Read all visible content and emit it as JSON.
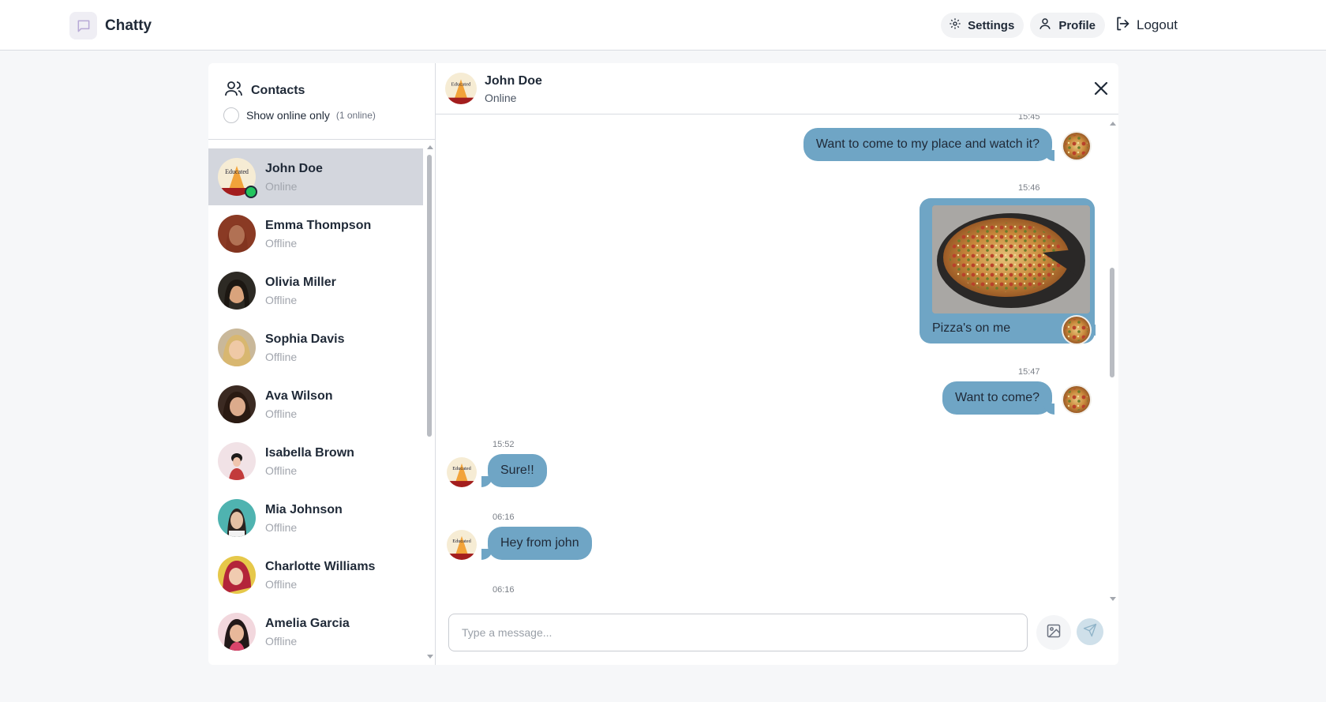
{
  "app": {
    "name": "Chatty"
  },
  "nav": {
    "settings": "Settings",
    "profile": "Profile",
    "logout": "Logout"
  },
  "sidebar": {
    "title": "Contacts",
    "filter_label": "Show online only",
    "online_count": "(1 online)",
    "contacts": [
      {
        "name": "John Doe",
        "status": "Online"
      },
      {
        "name": "Emma Thompson",
        "status": "Offline"
      },
      {
        "name": "Olivia Miller",
        "status": "Offline"
      },
      {
        "name": "Sophia Davis",
        "status": "Offline"
      },
      {
        "name": "Ava Wilson",
        "status": "Offline"
      },
      {
        "name": "Isabella Brown",
        "status": "Offline"
      },
      {
        "name": "Mia Johnson",
        "status": "Offline"
      },
      {
        "name": "Charlotte Williams",
        "status": "Offline"
      },
      {
        "name": "Amelia Garcia",
        "status": "Offline"
      }
    ]
  },
  "chat": {
    "name": "John Doe",
    "status": "Online",
    "messages": [
      {
        "time": "15:45",
        "text": "Want to come to my place and watch it?"
      },
      {
        "time": "15:46",
        "text": "Pizza's on me"
      },
      {
        "time": "15:47",
        "text": "Want to come?"
      },
      {
        "time": "15:52",
        "text": "Sure!!"
      },
      {
        "time": "06:16",
        "text": "Hey from john"
      },
      {
        "time": "06:16",
        "text": ""
      }
    ],
    "input_placeholder": "Type a message..."
  },
  "colors": {
    "bubble": "#6fa5c5",
    "online": "#22c55e",
    "active_row": "#d3d6dd"
  }
}
